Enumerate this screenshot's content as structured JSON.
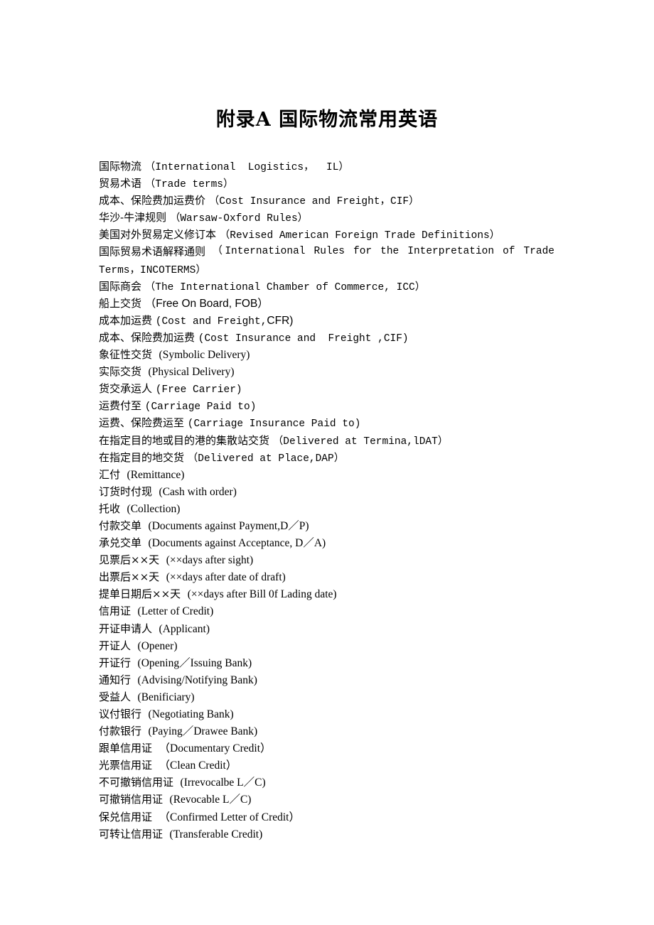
{
  "title": "附录A 国际物流常用英语",
  "entries": [
    {
      "zh": "国际物流 ",
      "en": "（International  Logistics，  IL）",
      "style": "mono"
    },
    {
      "zh": "贸易术语 ",
      "en": "（Trade terms）",
      "style": "mono"
    },
    {
      "zh": "成本、保险费加运费价 ",
      "en": "（Cost Insurance and Freight，CIF）",
      "style": "mono"
    },
    {
      "zh": "华沙-牛津规则 ",
      "en": "（Warsaw-Oxford Rules）",
      "style": "mono"
    },
    {
      "zh": "美国对外贸易定义修订本 ",
      "en": "（Revised American Foreign Trade Definitions）",
      "style": "mono"
    },
    {
      "zh": "国际贸易术语解释通则  ",
      "en": "（International Rules for the Interpretation of Trade",
      "style": "mono",
      "justify": true
    },
    {
      "zh": "",
      "en": "Terms，INCOTERMS）",
      "style": "mono"
    },
    {
      "zh": "国际商会 ",
      "en": "（The International Chamber of Commerce, ICC）",
      "style": "mono"
    },
    {
      "zh": "船上交货 ",
      "en": "（Free On Board, FOB）",
      "style": "sans"
    },
    {
      "zh": "成本加运费 ",
      "en": "(Cost and Freight,",
      "en2": "CFR)",
      "style": "mono",
      "style2": "sans"
    },
    {
      "zh": "成本、保险费加运费 ",
      "en": "(Cost Insurance and  Freight ,CIF)",
      "style": "mono"
    },
    {
      "zh": "象征性交货  ",
      "en": "(Symbolic Delivery)",
      "style": "serif"
    },
    {
      "zh": "实际交货  ",
      "en": "(Physical Delivery)",
      "style": "serif"
    },
    {
      "zh": "货交承运人 ",
      "en": "(Free Carrier)",
      "style": "mono"
    },
    {
      "zh": "运费付至 ",
      "en": "(Carriage Paid to)",
      "style": "mono"
    },
    {
      "zh": "运费、保险费运至 ",
      "en": "(Carriage Insurance Paid to)",
      "style": "mono"
    },
    {
      "zh": "在指定目的地或目的港的集散站交货 ",
      "en": "（Delivered at Termina,lDAT）",
      "style": "mono"
    },
    {
      "zh": "在指定目的地交货 ",
      "en": "（Delivered at Place,DAP）",
      "style": "mono"
    },
    {
      "zh": "汇付  ",
      "en": "(Remittance)",
      "style": "serif"
    },
    {
      "zh": "订货时付现  ",
      "en": "(Cash with order)",
      "style": "serif"
    },
    {
      "zh": "托收  ",
      "en": "(Collection)",
      "style": "serif"
    },
    {
      "zh": "付款交单  ",
      "en": "(Documents against Payment,D／P)",
      "style": "serif"
    },
    {
      "zh": "承兑交单  ",
      "en": "(Documents against Acceptance, D／A)",
      "style": "serif"
    },
    {
      "zh": "见票后××天  ",
      "en": "(××days after sight)",
      "style": "serif"
    },
    {
      "zh": "出票后××天  ",
      "en": "(××days after date of draft)",
      "style": "serif"
    },
    {
      "zh": "提单日期后××天  ",
      "en": "(××days after Bill 0f Lading date)",
      "style": "serif"
    },
    {
      "zh": "信用证  ",
      "en": "(Letter of Credit)",
      "style": "serif"
    },
    {
      "zh": "开证申请人  ",
      "en": "(Applicant)",
      "style": "serif"
    },
    {
      "zh": "开证人  ",
      "en": "(Opener)",
      "style": "serif"
    },
    {
      "zh": "开证行  ",
      "en": "(Opening／Issuing Bank)",
      "style": "serif"
    },
    {
      "zh": "通知行  ",
      "en": "(Advising/Notifying Bank)",
      "style": "serif"
    },
    {
      "zh": "受益人  ",
      "en": "(Benificiary)",
      "style": "serif"
    },
    {
      "zh": "议付银行  ",
      "en": "(Negotiating Bank)",
      "style": "serif"
    },
    {
      "zh": "付款银行  ",
      "en": "(Paying／Drawee Bank)",
      "style": "serif"
    },
    {
      "zh": "跟单信用证  ",
      "en": "（Documentary Credit）",
      "style": "serif"
    },
    {
      "zh": "光票信用证  ",
      "en": "（Clean Credit）",
      "style": "serif"
    },
    {
      "zh": "不可撤销信用证  ",
      "en": "(Irrevocalbe L／C)",
      "style": "serif"
    },
    {
      "zh": "可撤销信用证  ",
      "en": "(Revocable L／C)",
      "style": "serif"
    },
    {
      "zh": "保兑信用证  ",
      "en": "（Confirmed Letter of Credit）",
      "style": "serif"
    },
    {
      "zh": "可转让信用证  ",
      "en": "(Transferable Credit)",
      "style": "serif"
    }
  ]
}
